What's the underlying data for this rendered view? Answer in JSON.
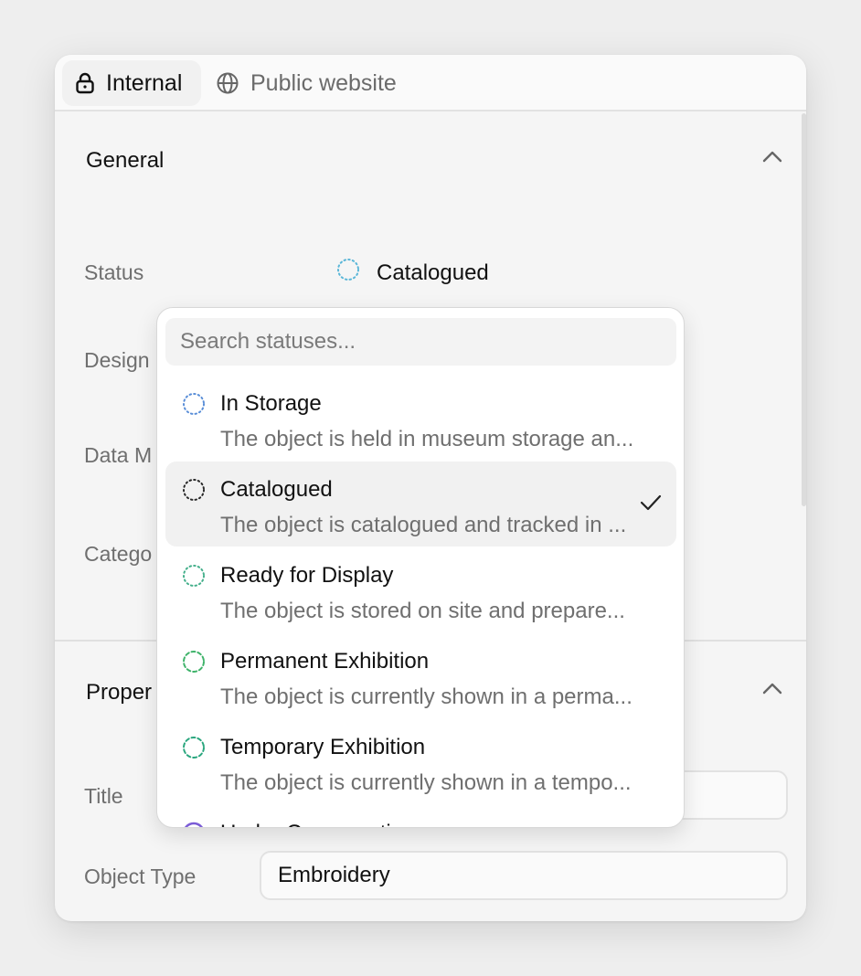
{
  "tabs": [
    {
      "label": "Internal",
      "icon": "lock-icon",
      "active": true
    },
    {
      "label": "Public website",
      "icon": "globe-icon",
      "active": false
    }
  ],
  "general": {
    "title": "General",
    "status_label": "Status",
    "status_value": "Catalogued",
    "designation_label": "Design",
    "data_label": "Data M",
    "category_label": "Catego"
  },
  "properties": {
    "title": "Proper",
    "title_label": "Title",
    "object_type_label": "Object Type",
    "object_type_value": "Embroidery"
  },
  "dropdown": {
    "search_placeholder": "Search statuses...",
    "options": [
      {
        "name": "In Storage",
        "desc": "The object is held in museum storage an...",
        "color": "#5b8fd8",
        "dash": "1.5 3.2",
        "selected": false
      },
      {
        "name": "Catalogued",
        "desc": "The object is catalogued and tracked in ...",
        "color": "#2a2a2a",
        "dash": "1.5 3.2",
        "selected": true
      },
      {
        "name": "Ready for Display",
        "desc": "The object is stored on site and prepare...",
        "color": "#46b08c",
        "dash": "1.5 3.2",
        "selected": false
      },
      {
        "name": "Permanent Exhibition",
        "desc": "The object is currently shown in a perma...",
        "color": "#3fb36a",
        "dash": "4 3",
        "selected": false
      },
      {
        "name": "Temporary Exhibition",
        "desc": "The object is currently shown in a tempo...",
        "color": "#2aa67e",
        "dash": "4 3",
        "selected": false
      },
      {
        "name": "Under Conservation",
        "desc": "",
        "color": "#7b5cd6",
        "dash": "",
        "selected": false
      }
    ]
  },
  "colors": {
    "status_catalogued": "#5bb7d8",
    "accent_text": "#111111"
  }
}
